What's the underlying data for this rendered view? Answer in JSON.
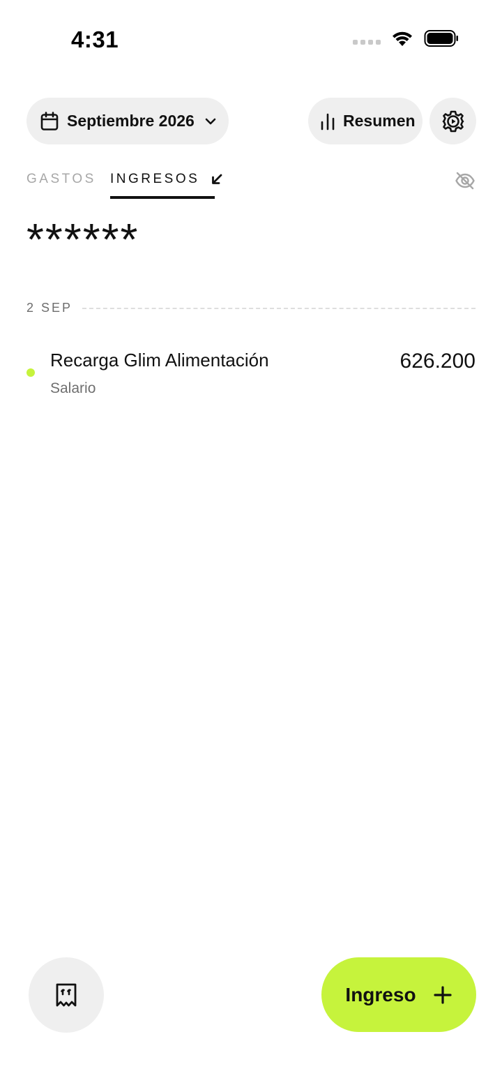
{
  "status_bar": {
    "time": "4:31"
  },
  "header": {
    "month_selector": {
      "label": "Septiembre 2026"
    },
    "summary_button": {
      "label": "Resumen"
    }
  },
  "tabs": [
    {
      "label": "GASTOS",
      "active": false
    },
    {
      "label": "INGRESOS",
      "active": true
    }
  ],
  "total": {
    "masked_value": "******"
  },
  "transactions_groups": [
    {
      "date": "2 SEP",
      "items": [
        {
          "title": "Recarga Glim Alimentación",
          "category": "Salario",
          "amount": "626.200",
          "dot_color": "#c6f33c"
        }
      ]
    }
  ],
  "bottom": {
    "add_button": {
      "label": "Ingreso"
    }
  },
  "colors": {
    "accent": "#c6f33c",
    "pill_bg": "#efefef",
    "text": "#111111",
    "muted": "#a7a7a7"
  },
  "icons": [
    "calendar-icon",
    "chevron-down-icon",
    "bar-chart-icon",
    "gear-icon",
    "arrow-down-left-icon",
    "eye-off-icon",
    "receipt-icon",
    "plus-icon",
    "wifi-icon",
    "battery-icon",
    "signal-icon"
  ]
}
